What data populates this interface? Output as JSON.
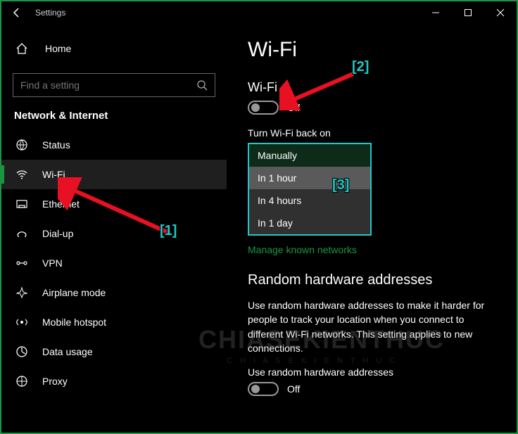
{
  "window": {
    "title": "Settings"
  },
  "sidebar": {
    "home": "Home",
    "search_placeholder": "Find a setting",
    "group": "Network & Internet",
    "items": [
      {
        "label": "Status"
      },
      {
        "label": "Wi-Fi"
      },
      {
        "label": "Ethernet"
      },
      {
        "label": "Dial-up"
      },
      {
        "label": "VPN"
      },
      {
        "label": "Airplane mode"
      },
      {
        "label": "Mobile hotspot"
      },
      {
        "label": "Data usage"
      },
      {
        "label": "Proxy"
      }
    ]
  },
  "main": {
    "page_title": "Wi-Fi",
    "wifi_section_label": "Wi-Fi",
    "wifi_toggle_state": "Off",
    "turn_back_label": "Turn Wi-Fi back on",
    "options": [
      "Manually",
      "In 1 hour",
      "In 4 hours",
      "In 1 day"
    ],
    "manage_link": "Manage known networks",
    "random_heading": "Random hardware addresses",
    "random_body": "Use random hardware addresses to make it harder for people to track your location when you connect to different Wi-Fi networks. This setting applies to new connections.",
    "random_toggle_label": "Use random hardware addresses",
    "random_toggle_state": "Off"
  },
  "annotations": {
    "a1": "[1]",
    "a2": "[2]",
    "a3": "[3]"
  },
  "watermark": {
    "main": "CHIASEKIENTHUC",
    "sub": "C H I A  S E  K I E N  T H U C"
  }
}
